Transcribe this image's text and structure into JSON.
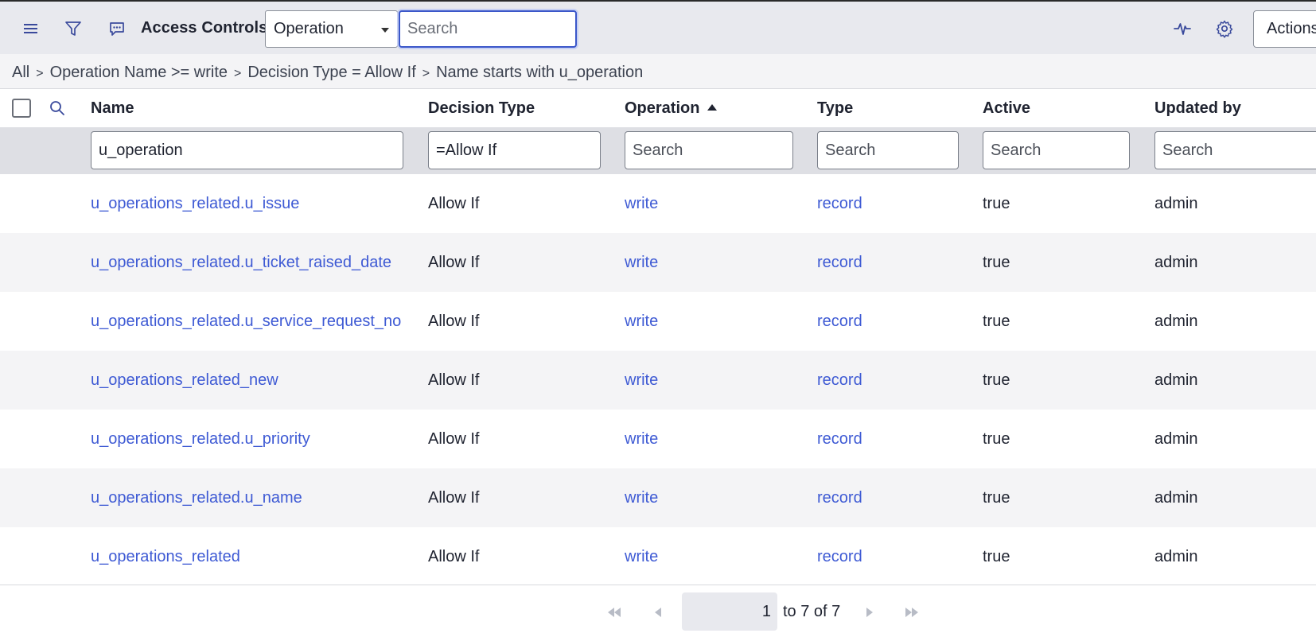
{
  "header": {
    "title": "Access Controls",
    "field_select": "Operation",
    "search_placeholder": "Search",
    "actions_label": "Actions"
  },
  "breadcrumb": [
    "All",
    "Operation Name >= write",
    "Decision Type = Allow If",
    "Name starts with u_operation"
  ],
  "breadcrumb_sep": ">",
  "columns": {
    "name": "Name",
    "decision_type": "Decision Type",
    "operation": "Operation",
    "type": "Type",
    "active": "Active",
    "updated_by": "Updated by"
  },
  "filters": {
    "name": "u_operation",
    "decision_type": "=Allow If",
    "operation_placeholder": "Search",
    "type_placeholder": "Search",
    "active_placeholder": "Search",
    "updated_by_placeholder": "Search"
  },
  "rows": [
    {
      "name": "u_operations_related.u_issue",
      "decision_type": "Allow If",
      "operation": "write",
      "type": "record",
      "active": "true",
      "updated_by": "admin"
    },
    {
      "name": "u_operations_related.u_ticket_raised_date",
      "decision_type": "Allow If",
      "operation": "write",
      "type": "record",
      "active": "true",
      "updated_by": "admin"
    },
    {
      "name": "u_operations_related.u_service_request_no",
      "decision_type": "Allow If",
      "operation": "write",
      "type": "record",
      "active": "true",
      "updated_by": "admin"
    },
    {
      "name": "u_operations_related_new",
      "decision_type": "Allow If",
      "operation": "write",
      "type": "record",
      "active": "true",
      "updated_by": "admin"
    },
    {
      "name": "u_operations_related.u_priority",
      "decision_type": "Allow If",
      "operation": "write",
      "type": "record",
      "active": "true",
      "updated_by": "admin"
    },
    {
      "name": "u_operations_related.u_name",
      "decision_type": "Allow If",
      "operation": "write",
      "type": "record",
      "active": "true",
      "updated_by": "admin"
    },
    {
      "name": "u_operations_related",
      "decision_type": "Allow If",
      "operation": "write",
      "type": "record",
      "active": "true",
      "updated_by": "admin"
    }
  ],
  "pagination": {
    "current_page": "1",
    "range_text": "to 7 of 7"
  },
  "colors": {
    "link": "#3e5ad4",
    "focus": "#3b57c9",
    "topbar_bg": "#e8e9ee"
  },
  "icons": [
    "menu-icon",
    "filter-icon",
    "chat-icon",
    "pulse-icon",
    "gear-icon",
    "search-icon",
    "first-page-icon",
    "prev-page-icon",
    "next-page-icon",
    "last-page-icon"
  ]
}
